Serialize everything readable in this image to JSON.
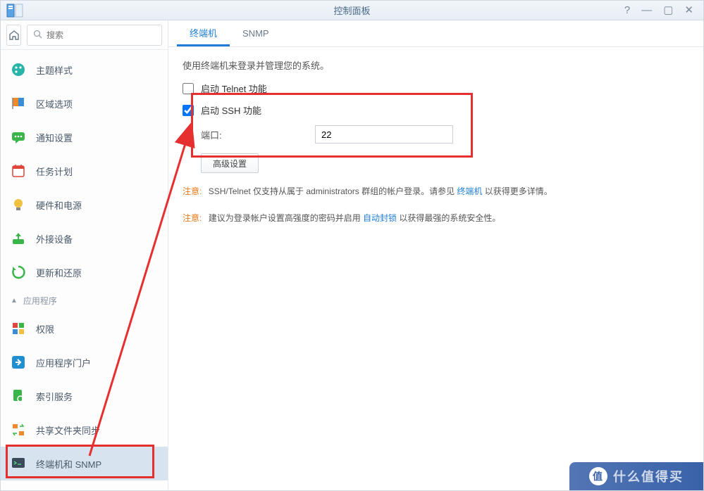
{
  "window": {
    "title": "控制面板"
  },
  "search": {
    "placeholder": "搜索"
  },
  "sidebar": {
    "items": [
      {
        "label": "主题样式"
      },
      {
        "label": "区域选项"
      },
      {
        "label": "通知设置"
      },
      {
        "label": "任务计划"
      },
      {
        "label": "硬件和电源"
      },
      {
        "label": "外接设备"
      },
      {
        "label": "更新和还原"
      }
    ],
    "section": "应用程序",
    "appItems": [
      {
        "label": "权限"
      },
      {
        "label": "应用程序门户"
      },
      {
        "label": "索引服务"
      },
      {
        "label": "共享文件夹同步"
      },
      {
        "label": "终端机和 SNMP"
      }
    ]
  },
  "tabs": [
    {
      "label": "终端机",
      "active": true
    },
    {
      "label": "SNMP",
      "active": false
    }
  ],
  "panel": {
    "description": "使用终端机来登录并管理您的系统。",
    "telnet_label": "启动 Telnet 功能",
    "ssh_label": "启动 SSH 功能",
    "port_label": "端口:",
    "port_value": "22",
    "advanced_label": "高级设置",
    "note1_label": "注意:",
    "note1_text_a": "SSH/Telnet 仅支持从属于 administrators 群组的帐户登录。请参见 ",
    "note1_link": "终端机",
    "note1_text_b": " 以获得更多详情。",
    "note2_label": "注意:",
    "note2_text_a": "建议为登录帐户设置高强度的密码并启用 ",
    "note2_link": "自动封锁",
    "note2_text_b": " 以获得最强的系统安全性。"
  },
  "watermark": "什么值得买"
}
